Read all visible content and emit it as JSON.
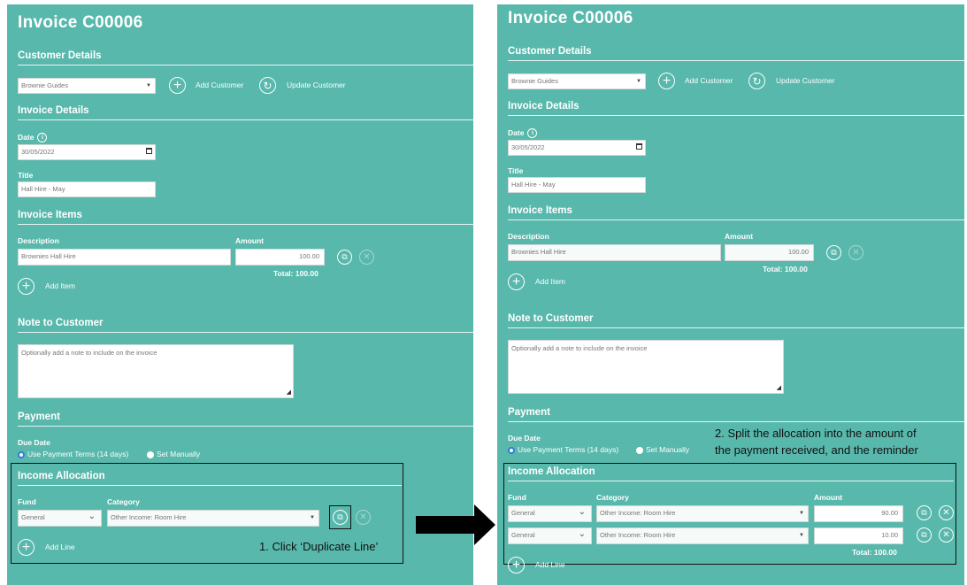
{
  "left": {
    "title": "Invoice C00006",
    "customer_details": {
      "heading": "Customer Details",
      "customer_value": "Brownie Guides",
      "add_customer": "Add Customer",
      "update_customer": "Update Customer"
    },
    "invoice_details": {
      "heading": "Invoice Details",
      "date_label": "Date",
      "date_value": "30/05/2022",
      "title_label": "Title",
      "title_value": "Hall Hire - May"
    },
    "invoice_items": {
      "heading": "Invoice Items",
      "description_label": "Description",
      "amount_label": "Amount",
      "description_value": "Brownies Hall Hire",
      "amount_value": "100.00",
      "total": "Total: 100.00",
      "add_item": "Add Item"
    },
    "note": {
      "heading": "Note to Customer",
      "placeholder": "Optionally add a note to include on the invoice"
    },
    "payment": {
      "heading": "Payment",
      "due_date_label": "Due Date",
      "option_terms": "Use Payment Terms (14 days)",
      "option_manual": "Set Manually"
    },
    "income_allocation": {
      "heading": "Income Allocation",
      "fund_label": "Fund",
      "category_label": "Category",
      "fund_value": "General",
      "category_value": "Other Income: Room Hire",
      "add_line": "Add Line"
    },
    "annotation": "1. Click ‘Duplicate Line’"
  },
  "right": {
    "title": "Invoice C00006",
    "customer_details": {
      "heading": "Customer Details",
      "customer_value": "Brownie Guides",
      "add_customer": "Add Customer",
      "update_customer": "Update Customer"
    },
    "invoice_details": {
      "heading": "Invoice Details",
      "date_label": "Date",
      "date_value": "30/05/2022",
      "title_label": "Title",
      "title_value": "Hall Hire - May"
    },
    "invoice_items": {
      "heading": "Invoice Items",
      "description_label": "Description",
      "amount_label": "Amount",
      "description_value": "Brownies Hall Hire",
      "amount_value": "100.00",
      "total": "Total: 100.00",
      "add_item": "Add Item"
    },
    "note": {
      "heading": "Note to Customer",
      "placeholder": "Optionally add a note to include on the invoice"
    },
    "payment": {
      "heading": "Payment",
      "due_date_label": "Due Date",
      "option_terms": "Use Payment Terms (14 days)",
      "option_manual": "Set Manually"
    },
    "income_allocation": {
      "heading": "Income Allocation",
      "fund_label": "Fund",
      "category_label": "Category",
      "amount_label": "Amount",
      "lines": [
        {
          "fund": "General",
          "category": "Other Income: Room Hire",
          "amount": "90.00"
        },
        {
          "fund": "General",
          "category": "Other Income: Room Hire",
          "amount": "10.00"
        }
      ],
      "total": "Total: 100.00",
      "add_line": "Add Line"
    },
    "annotation_line1": "2. Split the allocation into the amount of",
    "annotation_line2": "the payment received, and the reminder"
  },
  "colors": {
    "panel_bg": "#58b8ac",
    "radio_selected": "#2c7fd8",
    "annotation_border": "#111111"
  }
}
